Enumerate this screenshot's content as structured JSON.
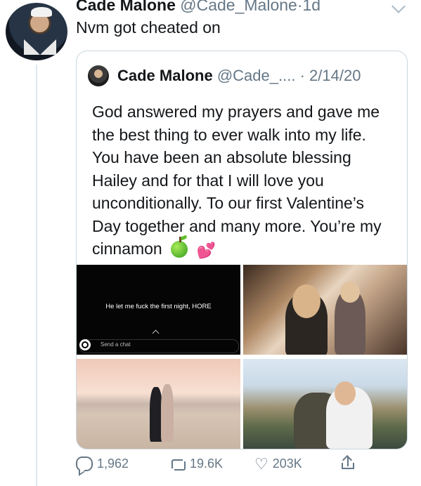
{
  "tweet": {
    "author_name": "Cade Malone",
    "author_handle": "@Cade_Malone",
    "separator": "·",
    "time": "1d",
    "text": "Nvm got cheated on"
  },
  "quoted_tweet": {
    "author_name": "Cade Malone",
    "author_handle": "@Cade_....",
    "separator": "·",
    "date": "2/14/20",
    "text": "God answered my prayers and gave me the best thing to ever walk into my life. You have been an absolute blessing Hailey and for that I will love you unconditionally. To our first Valentine’s Day together and many more. You’re my cinnamon",
    "emojis": [
      "green-apple-icon",
      "two-hearts-icon"
    ],
    "media": {
      "snap_caption": "He let me fuck the first night, HORE",
      "snap_send_placeholder": "Send a chat"
    }
  },
  "actions": {
    "replies": "1,962",
    "retweets": "19.6K",
    "likes": "203K"
  },
  "icons": [
    "chevron-down-icon",
    "reply-icon",
    "retweet-icon",
    "like-icon",
    "share-icon",
    "camera-icon"
  ],
  "colors": {
    "text": "#14171a",
    "secondary": "#657786",
    "border": "#ccd6dd",
    "heart_emoji": "#ff5fa0"
  }
}
